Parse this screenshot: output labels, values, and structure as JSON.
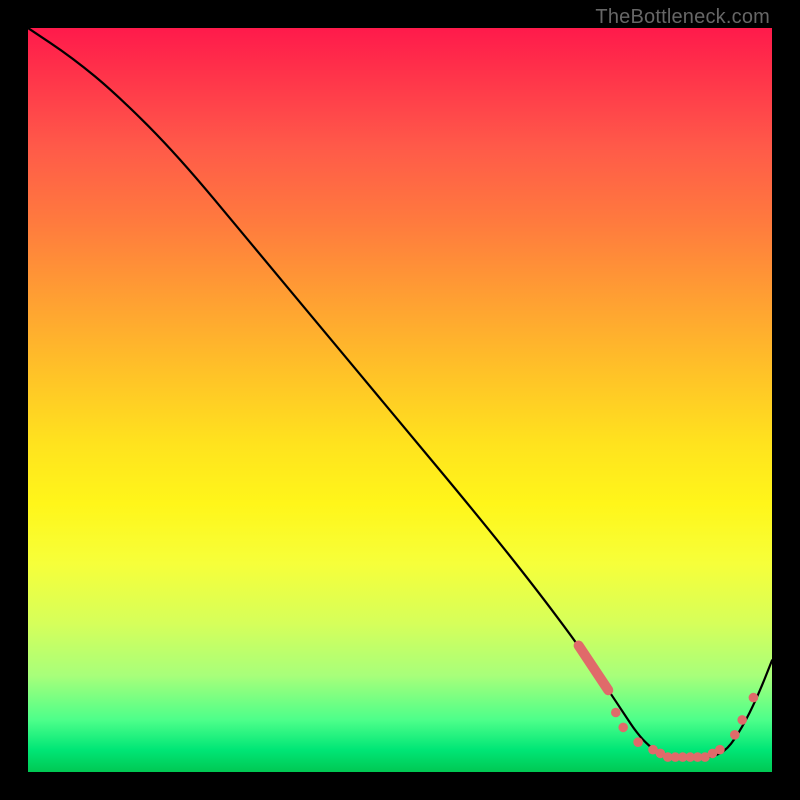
{
  "attribution": "TheBottleneck.com",
  "colors": {
    "frame": "#000000",
    "dot": "#e06a6a",
    "line": "#000000"
  },
  "chart_data": {
    "type": "line",
    "title": "",
    "xlabel": "",
    "ylabel": "",
    "xlim": [
      0,
      100
    ],
    "ylim": [
      0,
      100
    ],
    "grid": false,
    "series": [
      {
        "name": "curve",
        "x": [
          0,
          6,
          12,
          20,
          30,
          40,
          50,
          60,
          68,
          74,
          78,
          80,
          82,
          84,
          86,
          88,
          90,
          92,
          94,
          96,
          98,
          100
        ],
        "y": [
          100,
          96,
          91,
          83,
          71,
          59,
          47,
          35,
          25,
          17,
          11,
          8,
          5,
          3,
          2,
          2,
          2,
          2,
          3,
          6,
          10,
          15
        ]
      }
    ],
    "highlight_segment": {
      "x_start": 74,
      "x_end": 78
    },
    "markers": [
      {
        "x": 79,
        "y": 8
      },
      {
        "x": 80,
        "y": 6
      },
      {
        "x": 82,
        "y": 4
      },
      {
        "x": 84,
        "y": 3
      },
      {
        "x": 85,
        "y": 2.5
      },
      {
        "x": 86,
        "y": 2
      },
      {
        "x": 87,
        "y": 2
      },
      {
        "x": 88,
        "y": 2
      },
      {
        "x": 89,
        "y": 2
      },
      {
        "x": 90,
        "y": 2
      },
      {
        "x": 91,
        "y": 2
      },
      {
        "x": 92,
        "y": 2.5
      },
      {
        "x": 93,
        "y": 3
      },
      {
        "x": 95,
        "y": 5
      },
      {
        "x": 96,
        "y": 7
      },
      {
        "x": 97.5,
        "y": 10
      }
    ]
  }
}
